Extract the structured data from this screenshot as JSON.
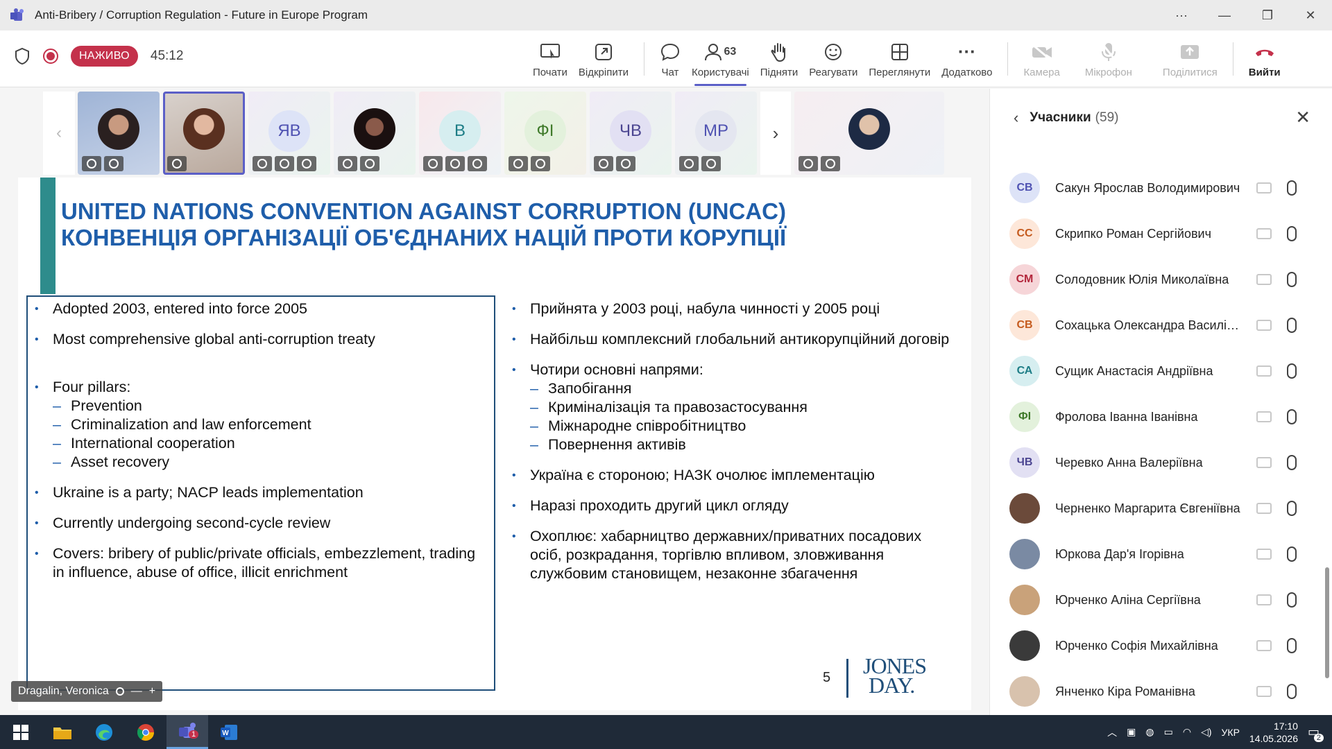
{
  "window": {
    "title": "Anti-Bribery / Corruption Regulation - Future in Europe Program",
    "controls": [
      "···",
      "—",
      "❐",
      "✕"
    ]
  },
  "meeting": {
    "live_label": "НАЖИВО",
    "timer": "45:12",
    "toolbar": [
      {
        "id": "share",
        "label": "Почати"
      },
      {
        "id": "popout",
        "label": "Відкріпити"
      },
      {
        "id": "chat",
        "label": "Чат"
      },
      {
        "id": "people",
        "label": "Користувачі",
        "count": "63"
      },
      {
        "id": "raise",
        "label": "Підняти"
      },
      {
        "id": "react",
        "label": "Реагувати"
      },
      {
        "id": "view",
        "label": "Переглянути"
      },
      {
        "id": "more",
        "label": "Додатково"
      },
      {
        "id": "camera",
        "label": "Камера"
      },
      {
        "id": "mic",
        "label": "Мікрофон"
      },
      {
        "id": "share2",
        "label": "Поділитися"
      },
      {
        "id": "leave",
        "label": "Вийти"
      }
    ]
  },
  "video_tiles": [
    {
      "initials": "",
      "kind": "photo1"
    },
    {
      "initials": "",
      "kind": "photo2",
      "selected": true
    },
    {
      "initials": "ЯВ"
    },
    {
      "initials": "",
      "kind": "dark"
    },
    {
      "initials": "В"
    },
    {
      "initials": "ФІ"
    },
    {
      "initials": "ЧВ"
    },
    {
      "initials": "МР"
    }
  ],
  "slide": {
    "title_en": "UNITED NATIONS CONVENTION AGAINST CORRUPTION (UNCAC)",
    "title_uk": "КОНВЕНЦІЯ ОРГАНІЗАЦІЇ ОБ'ЄДНАНИХ НАЦІЙ ПРОТИ КОРУПЦІЇ",
    "left": {
      "b1": "Adopted 2003, entered into force 2005",
      "b2": "Most comprehensive global anti-corruption treaty",
      "b3": "Four pillars:",
      "sub": [
        "Prevention",
        "Criminalization and law enforcement",
        "International cooperation",
        "Asset recovery"
      ],
      "b4": "Ukraine is a party; NACP leads implementation",
      "b5": "Currently undergoing second-cycle review",
      "b6": "Covers: bribery of public/private officials, embezzlement, trading in influence, abuse of office, illicit enrichment"
    },
    "right": {
      "b1": "Прийнята у 2003 році, набула чинності у 2005 році",
      "b2": "Найбільш комплексний глобальний антикорупційний договір",
      "b3": "Чотири основні напрями:",
      "sub": [
        "Запобігання",
        "Криміналізація та правозастосування",
        "Міжнародне співробітництво",
        "Повернення активів"
      ],
      "b4": "Україна є стороною; НАЗК очолює імплементацію",
      "b5": "Наразі проходить другий цикл огляду",
      "b6": "Охоплює: хабарництво державних/приватних посадових осіб, розкрадання, торгівлю впливом, зловживання службовим становищем, незаконне збагачення"
    },
    "page_number": "5",
    "logo_line1": "JONES",
    "logo_line2": "DAY."
  },
  "speaker_label": "Dragalin, Veronica",
  "panel": {
    "title": "Учасники",
    "count": "(59)",
    "participants": [
      {
        "initials": "СВ",
        "name": "Сакун Ярослав Володимирович",
        "bg": "#dde3f7",
        "fg": "#4f52b2"
      },
      {
        "initials": "СС",
        "name": "Скрипко Роман Сергійович",
        "bg": "#fde7d9",
        "fg": "#c55b1e"
      },
      {
        "initials": "СМ",
        "name": "Солодовник Юлія Миколаївна",
        "bg": "#f6d5d8",
        "fg": "#b3273c"
      },
      {
        "initials": "СВ",
        "name": "Сохацька Олександра Василівна",
        "bg": "#fde7d9",
        "fg": "#c55b1e"
      },
      {
        "initials": "СА",
        "name": "Сущик Анастасія Андріївна",
        "bg": "#d6eef0",
        "fg": "#1d7d86"
      },
      {
        "initials": "ФІ",
        "name": "Фролова Іванна Іванівна",
        "bg": "#e3f1dc",
        "fg": "#3f7a2a"
      },
      {
        "initials": "ЧВ",
        "name": "Черевко Анна Валеріївна",
        "bg": "#e2e0f3",
        "fg": "#4b4591"
      },
      {
        "initials": "",
        "name": "Черненко Маргарита Євгеніївна",
        "bg": "#6b4a3a",
        "fg": "#fff"
      },
      {
        "initials": "",
        "name": "Юркова Дар'я Ігорівна",
        "bg": "#7a8aa3",
        "fg": "#fff"
      },
      {
        "initials": "",
        "name": "Юрченко Аліна Сергіївна",
        "bg": "#c9a27a",
        "fg": "#fff"
      },
      {
        "initials": "",
        "name": "Юрченко Софія Михайлівна",
        "bg": "#3a3a3a",
        "fg": "#fff"
      },
      {
        "initials": "",
        "name": "Янченко Кіра Романівна",
        "bg": "#d8c2ad",
        "fg": "#fff"
      }
    ]
  },
  "taskbar": {
    "lang": "УКР",
    "time": "17:10",
    "date": "14.05.2026",
    "notif": "2",
    "teams_badge": "1"
  }
}
